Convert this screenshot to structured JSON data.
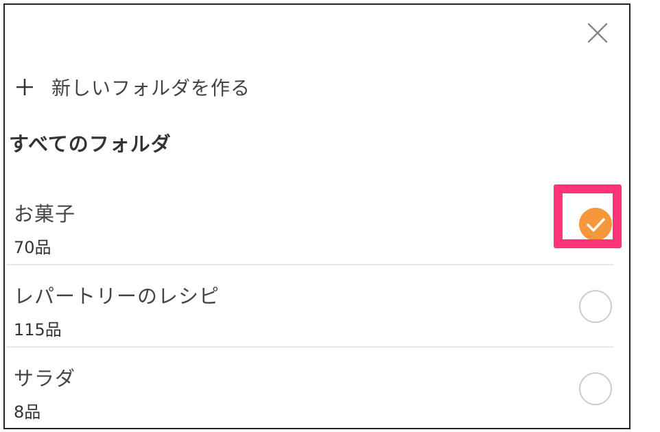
{
  "dialog": {
    "close_icon": "close-icon",
    "new_folder": {
      "icon": "plus-icon",
      "label": "新しいフォルダを作る"
    },
    "section_heading": "すべてのフォルダ",
    "folders": [
      {
        "name": "お菓子",
        "count": "70品",
        "selected": true
      },
      {
        "name": "レパートリーのレシピ",
        "count": "115品",
        "selected": false
      },
      {
        "name": "サラダ",
        "count": "8品",
        "selected": false
      }
    ]
  },
  "colors": {
    "accent": "#f5973a",
    "highlight": "#ff3377",
    "divider": "#e6e6e6",
    "radio_border": "#cccccc"
  }
}
